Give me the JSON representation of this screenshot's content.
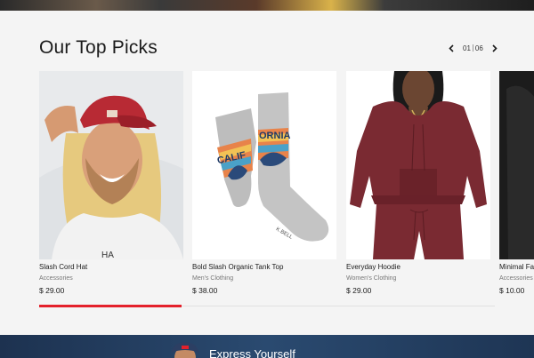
{
  "section": {
    "title": "Our Top Picks"
  },
  "pager": {
    "current": "01",
    "total": "06",
    "prev_icon": "chevron-left-icon",
    "next_icon": "chevron-right-icon"
  },
  "products": [
    {
      "name": "Slash Cord Hat",
      "category": "Accessories",
      "price": "$ 29.00"
    },
    {
      "name": "Bold Slash Organic Tank Top",
      "category": "Men's Clothing",
      "price": "$ 38.00"
    },
    {
      "name": "Everyday Hoodie",
      "category": "Women's Clothing",
      "price": "$ 29.00"
    },
    {
      "name": "Minimal Fa",
      "category": "Accessories",
      "price": "$ 10.00"
    }
  ],
  "sock": {
    "left_text": "CALIF",
    "right_text": "ORNIA",
    "brand": "K.BELL"
  },
  "hat": {
    "text": "HA"
  },
  "carousel_progress": 0.3125,
  "banner": {
    "text": "Express Yourself"
  },
  "colors": {
    "accent": "#e4212b",
    "banner": "#2a4a70",
    "hoodie": "#7a2a32"
  }
}
